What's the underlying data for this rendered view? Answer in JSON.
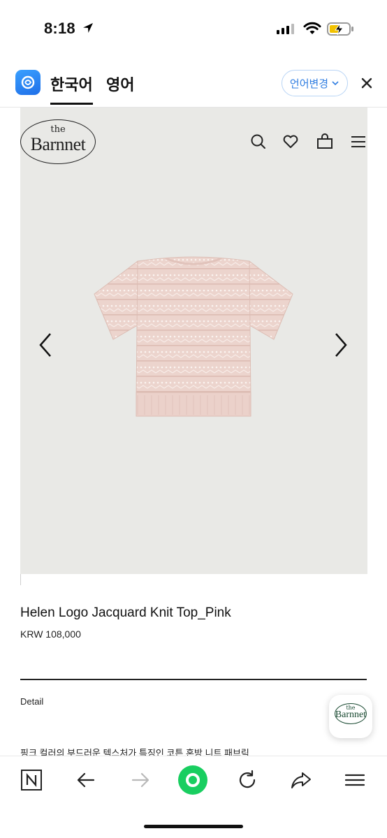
{
  "status_bar": {
    "time": "8:18"
  },
  "translate_bar": {
    "tabs": [
      "한국어",
      "영어"
    ],
    "active_tab": "한국어",
    "change_language_label": "언어변경",
    "accent_color": "#2f7de1"
  },
  "site": {
    "logo_the": "the",
    "logo_name": "Barnnet",
    "header_icons": [
      "search-icon",
      "heart-icon",
      "bag-icon",
      "menu-icon"
    ]
  },
  "product": {
    "title": "Helen Logo Jacquard Knit Top_Pink",
    "price": "KRW 108,000",
    "detail_label": "Detail",
    "detail_text": "핑크 컬러의 부드러운 텍스처가 특징인 코튼 혼방 니트 패브릭"
  },
  "float_logo": {
    "the": "the",
    "name": "Barnnet"
  },
  "toolbar": {
    "icons": [
      "naver-icon",
      "back-icon",
      "forward-icon",
      "home-icon",
      "reload-icon",
      "share-icon",
      "menu-icon"
    ],
    "home_color": "#19ce60"
  }
}
